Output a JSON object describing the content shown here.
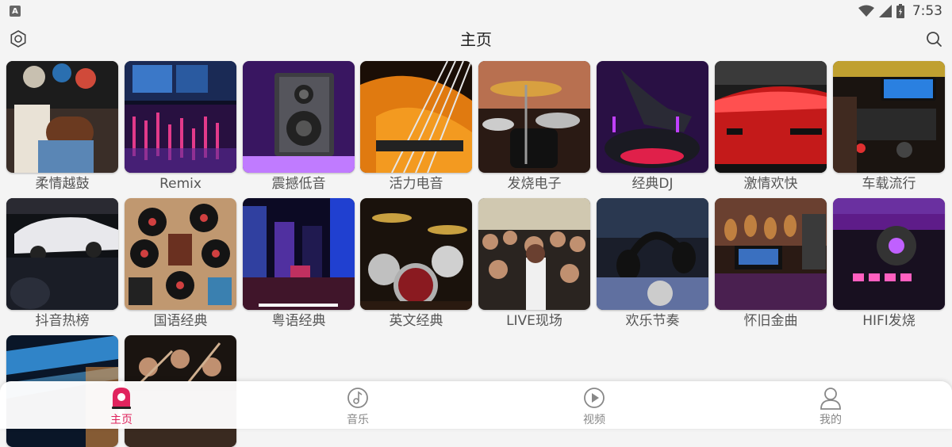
{
  "status_bar": {
    "app_indicator": "A",
    "time": "7:53"
  },
  "header": {
    "title": "主页"
  },
  "categories": [
    {
      "label": "柔情越鼓",
      "image": "drummer-photo"
    },
    {
      "label": "Remix",
      "image": "mixing-console-photo"
    },
    {
      "label": "震撼低音",
      "image": "speaker-photo"
    },
    {
      "label": "活力电音",
      "image": "bass-guitar-photo"
    },
    {
      "label": "发烧电子",
      "image": "drum-kit-photo"
    },
    {
      "label": "经典DJ",
      "image": "dj-turntable-photo"
    },
    {
      "label": "激情欢快",
      "image": "red-car-photo"
    },
    {
      "label": "车载流行",
      "image": "car-dashboard-photo"
    },
    {
      "label": "抖音热榜",
      "image": "race-car-photo"
    },
    {
      "label": "国语经典",
      "image": "vinyl-records-photo"
    },
    {
      "label": "粤语经典",
      "image": "city-night-photo"
    },
    {
      "label": "英文经典",
      "image": "drum-set-photo"
    },
    {
      "label": "LIVE现场",
      "image": "concert-crowd-photo"
    },
    {
      "label": "欢乐节奏",
      "image": "headphones-photo"
    },
    {
      "label": "怀旧金曲",
      "image": "guitar-studio-photo"
    },
    {
      "label": "HIFI发烧",
      "image": "dj-controller-photo"
    },
    {
      "label": "",
      "image": "stage-lights-photo"
    },
    {
      "label": "",
      "image": "orchestra-photo"
    }
  ],
  "bottom_nav": {
    "items": [
      {
        "label": "主页",
        "icon": "home-icon",
        "active": true
      },
      {
        "label": "音乐",
        "icon": "music-icon",
        "active": false
      },
      {
        "label": "视频",
        "icon": "video-icon",
        "active": false
      },
      {
        "label": "我的",
        "icon": "profile-icon",
        "active": false
      }
    ]
  },
  "colors": {
    "accent": "#e0245e",
    "background": "#f4f4f4"
  }
}
